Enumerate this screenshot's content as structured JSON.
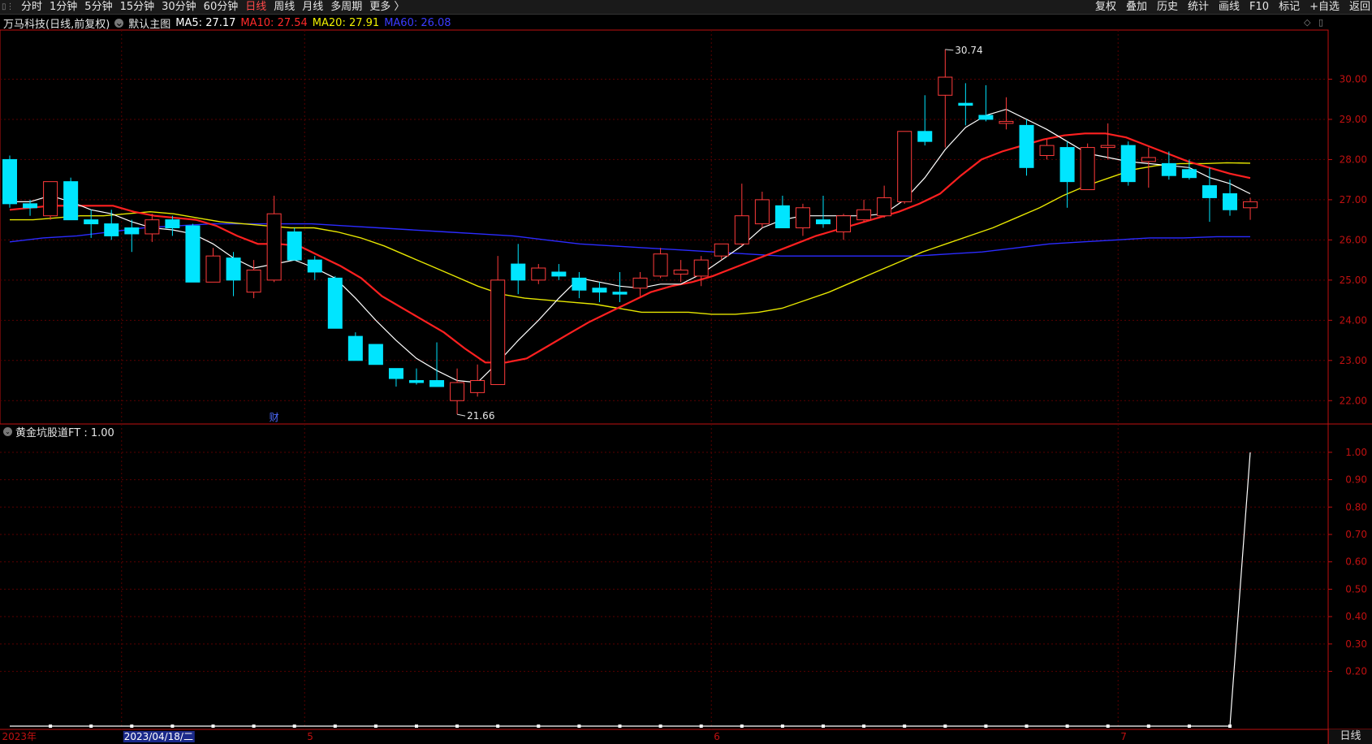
{
  "toolbar": {
    "tabs": [
      {
        "label": "分时",
        "active": false
      },
      {
        "label": "1分钟",
        "active": false
      },
      {
        "label": "5分钟",
        "active": false
      },
      {
        "label": "15分钟",
        "active": false
      },
      {
        "label": "30分钟",
        "active": false
      },
      {
        "label": "60分钟",
        "active": false
      },
      {
        "label": "日线",
        "active": true
      },
      {
        "label": "周线",
        "active": false
      },
      {
        "label": "月线",
        "active": false
      },
      {
        "label": "多周期",
        "active": false
      },
      {
        "label": "更多 〉",
        "active": false
      }
    ],
    "right": [
      "复权",
      "叠加",
      "历史",
      "统计",
      "画线",
      "F10",
      "标记",
      "+自选",
      "返回"
    ]
  },
  "header": {
    "title": "万马科技(日线,前复权)",
    "main_chart_label": "默认主图",
    "ma5": "MA5: 27.17",
    "ma10": "MA10: 27.54",
    "ma20": "MA20: 27.91",
    "ma60": "MA60: 26.08"
  },
  "indicator": {
    "label": "黄金坑股道FT : 1.00"
  },
  "bottom_right_label": "日线",
  "colors": {
    "up": "#ff3b3b",
    "down": "#00e5ff",
    "ma5": "#ffffff",
    "ma10": "#ff2020",
    "ma20": "#e6e600",
    "ma60": "#2b2bff",
    "grid": "#5a0000",
    "axis": "#c01010"
  },
  "chart_data": [
    {
      "type": "candlestick",
      "ylim": [
        21.5,
        31.0
      ],
      "yticks": [
        "30.00",
        "29.00",
        "28.00",
        "27.00",
        "26.00",
        "25.00",
        "24.00",
        "23.00",
        "22.00"
      ],
      "annotations": [
        {
          "text": "30.74",
          "value": 30.74,
          "candle_index": 46
        },
        {
          "text": "21.66",
          "value": 21.66,
          "candle_index": 22
        }
      ],
      "finance_marker": {
        "text": "财",
        "candle_index": 13
      },
      "x_labels": [
        {
          "text": "2023年",
          "candle_index": 0
        },
        {
          "text": "2023/04/18/二",
          "candle_index": 6,
          "highlight": true
        },
        {
          "text": "5",
          "candle_index": 15
        },
        {
          "text": "6",
          "candle_index": 35
        },
        {
          "text": "7",
          "candle_index": 55
        }
      ],
      "candles": [
        {
          "o": 28.0,
          "h": 28.1,
          "l": 26.8,
          "c": 26.9
        },
        {
          "o": 26.9,
          "h": 27.0,
          "l": 26.6,
          "c": 26.8
        },
        {
          "o": 26.6,
          "h": 27.45,
          "l": 26.5,
          "c": 27.45
        },
        {
          "o": 27.45,
          "h": 27.55,
          "l": 26.5,
          "c": 26.5
        },
        {
          "o": 26.5,
          "h": 26.75,
          "l": 26.05,
          "c": 26.4
        },
        {
          "o": 26.4,
          "h": 26.75,
          "l": 26.0,
          "c": 26.1
        },
        {
          "o": 26.3,
          "h": 26.5,
          "l": 25.7,
          "c": 26.15
        },
        {
          "o": 26.15,
          "h": 26.65,
          "l": 25.95,
          "c": 26.5
        },
        {
          "o": 26.5,
          "h": 26.6,
          "l": 26.1,
          "c": 26.3
        },
        {
          "o": 26.35,
          "h": 26.4,
          "l": 24.95,
          "c": 24.95
        },
        {
          "o": 24.95,
          "h": 25.8,
          "l": 24.95,
          "c": 25.6
        },
        {
          "o": 25.55,
          "h": 25.7,
          "l": 24.6,
          "c": 25.0
        },
        {
          "o": 24.7,
          "h": 25.5,
          "l": 24.55,
          "c": 25.25
        },
        {
          "o": 25.0,
          "h": 27.1,
          "l": 24.95,
          "c": 26.65
        },
        {
          "o": 26.2,
          "h": 26.3,
          "l": 25.5,
          "c": 25.5
        },
        {
          "o": 25.5,
          "h": 25.6,
          "l": 25.0,
          "c": 25.2
        },
        {
          "o": 25.05,
          "h": 25.1,
          "l": 23.8,
          "c": 23.8
        },
        {
          "o": 23.6,
          "h": 23.7,
          "l": 23.05,
          "c": 23.0
        },
        {
          "o": 23.4,
          "h": 23.4,
          "l": 22.9,
          "c": 22.9
        },
        {
          "o": 22.8,
          "h": 22.8,
          "l": 22.35,
          "c": 22.55
        },
        {
          "o": 22.5,
          "h": 22.8,
          "l": 22.4,
          "c": 22.45
        },
        {
          "o": 22.5,
          "h": 23.45,
          "l": 22.35,
          "c": 22.35
        },
        {
          "o": 22.0,
          "h": 22.8,
          "l": 21.66,
          "c": 22.45
        },
        {
          "o": 22.2,
          "h": 22.9,
          "l": 22.1,
          "c": 22.5
        },
        {
          "o": 22.4,
          "h": 25.6,
          "l": 22.4,
          "c": 25.0
        },
        {
          "o": 25.4,
          "h": 25.9,
          "l": 24.65,
          "c": 25.0
        },
        {
          "o": 25.0,
          "h": 25.4,
          "l": 24.9,
          "c": 25.3
        },
        {
          "o": 25.2,
          "h": 25.4,
          "l": 25.0,
          "c": 25.1
        },
        {
          "o": 25.05,
          "h": 25.2,
          "l": 24.55,
          "c": 24.75
        },
        {
          "o": 24.8,
          "h": 24.95,
          "l": 24.45,
          "c": 24.7
        },
        {
          "o": 24.7,
          "h": 25.2,
          "l": 24.45,
          "c": 24.65
        },
        {
          "o": 24.8,
          "h": 25.2,
          "l": 24.6,
          "c": 25.05
        },
        {
          "o": 25.1,
          "h": 25.8,
          "l": 25.05,
          "c": 25.65
        },
        {
          "o": 25.15,
          "h": 25.5,
          "l": 24.95,
          "c": 25.25
        },
        {
          "o": 25.1,
          "h": 25.6,
          "l": 24.85,
          "c": 25.5
        },
        {
          "o": 25.6,
          "h": 25.9,
          "l": 25.5,
          "c": 25.9
        },
        {
          "o": 25.9,
          "h": 27.4,
          "l": 25.85,
          "c": 26.6
        },
        {
          "o": 26.4,
          "h": 27.2,
          "l": 26.3,
          "c": 27.0
        },
        {
          "o": 26.85,
          "h": 27.1,
          "l": 26.3,
          "c": 26.3
        },
        {
          "o": 26.3,
          "h": 26.9,
          "l": 26.1,
          "c": 26.8
        },
        {
          "o": 26.5,
          "h": 27.1,
          "l": 26.3,
          "c": 26.4
        },
        {
          "o": 26.2,
          "h": 26.65,
          "l": 26.0,
          "c": 26.6
        },
        {
          "o": 26.5,
          "h": 27.0,
          "l": 26.45,
          "c": 26.75
        },
        {
          "o": 26.6,
          "h": 27.35,
          "l": 26.55,
          "c": 27.05
        },
        {
          "o": 26.95,
          "h": 28.7,
          "l": 26.9,
          "c": 28.7
        },
        {
          "o": 28.7,
          "h": 29.6,
          "l": 28.35,
          "c": 28.45
        },
        {
          "o": 29.6,
          "h": 30.74,
          "l": 28.3,
          "c": 30.05
        },
        {
          "o": 29.4,
          "h": 29.9,
          "l": 28.85,
          "c": 29.35
        },
        {
          "o": 29.1,
          "h": 29.85,
          "l": 28.95,
          "c": 29.0
        },
        {
          "o": 28.9,
          "h": 29.55,
          "l": 28.75,
          "c": 28.95
        },
        {
          "o": 28.85,
          "h": 29.0,
          "l": 27.6,
          "c": 27.8
        },
        {
          "o": 28.1,
          "h": 28.5,
          "l": 28.0,
          "c": 28.35
        },
        {
          "o": 28.3,
          "h": 28.45,
          "l": 26.8,
          "c": 27.45
        },
        {
          "o": 27.25,
          "h": 28.4,
          "l": 27.25,
          "c": 28.3
        },
        {
          "o": 28.3,
          "h": 28.9,
          "l": 28.0,
          "c": 28.35
        },
        {
          "o": 28.35,
          "h": 28.45,
          "l": 27.35,
          "c": 27.45
        },
        {
          "o": 27.95,
          "h": 28.3,
          "l": 27.3,
          "c": 28.05
        },
        {
          "o": 27.9,
          "h": 28.2,
          "l": 27.5,
          "c": 27.6
        },
        {
          "o": 27.75,
          "h": 28.0,
          "l": 27.5,
          "c": 27.55
        },
        {
          "o": 27.35,
          "h": 27.8,
          "l": 26.45,
          "c": 27.05
        },
        {
          "o": 27.15,
          "h": 27.5,
          "l": 26.6,
          "c": 26.75
        },
        {
          "o": 26.8,
          "h": 27.05,
          "l": 26.5,
          "c": 26.95
        }
      ],
      "ma": {
        "MA5": [
          26.95,
          26.95,
          27.1,
          26.95,
          26.75,
          26.65,
          26.45,
          26.3,
          26.25,
          26.15,
          25.9,
          25.55,
          25.3,
          25.4,
          25.5,
          25.3,
          25.05,
          24.55,
          24.0,
          23.5,
          23.05,
          22.75,
          22.5,
          22.45,
          22.95,
          23.5,
          24.0,
          24.55,
          25.05,
          24.95,
          24.85,
          24.8,
          24.9,
          24.9,
          25.15,
          25.5,
          25.85,
          26.3,
          26.5,
          26.6,
          26.6,
          26.6,
          26.6,
          26.65,
          27.0,
          27.55,
          28.25,
          28.8,
          29.1,
          29.25,
          29.0,
          28.75,
          28.45,
          28.15,
          28.05,
          27.95,
          27.9,
          27.85,
          27.8,
          27.55,
          27.4,
          27.15
        ],
        "MA10": [
          26.75,
          26.8,
          26.85,
          26.85,
          26.85,
          26.85,
          26.7,
          26.6,
          26.55,
          26.5,
          26.35,
          26.1,
          25.9,
          25.9,
          25.85,
          25.6,
          25.35,
          25.05,
          24.6,
          24.3,
          24.0,
          23.7,
          23.3,
          22.95,
          22.95,
          23.05,
          23.35,
          23.65,
          23.95,
          24.2,
          24.45,
          24.7,
          24.85,
          24.95,
          25.1,
          25.3,
          25.5,
          25.7,
          25.9,
          26.1,
          26.25,
          26.4,
          26.55,
          26.7,
          26.9,
          27.15,
          27.6,
          28.0,
          28.2,
          28.35,
          28.5,
          28.6,
          28.65,
          28.65,
          28.55,
          28.35,
          28.15,
          27.95,
          27.8,
          27.65,
          27.54
        ],
        "MA20": [
          26.5,
          26.5,
          26.55,
          26.6,
          26.6,
          26.65,
          26.7,
          26.65,
          26.55,
          26.45,
          26.4,
          26.35,
          26.3,
          26.3,
          26.2,
          26.05,
          25.85,
          25.6,
          25.35,
          25.1,
          24.85,
          24.65,
          24.55,
          24.5,
          24.45,
          24.4,
          24.3,
          24.2,
          24.2,
          24.2,
          24.15,
          24.15,
          24.2,
          24.3,
          24.5,
          24.7,
          24.95,
          25.2,
          25.45,
          25.7,
          25.9,
          26.1,
          26.3,
          26.55,
          26.8,
          27.1,
          27.35,
          27.55,
          27.75,
          27.85,
          27.9,
          27.9,
          27.92,
          27.91
        ],
        "MA60": [
          25.95,
          26.05,
          26.1,
          26.2,
          26.3,
          26.35,
          26.4,
          26.4,
          26.4,
          26.4,
          26.35,
          26.3,
          26.25,
          26.2,
          26.15,
          26.1,
          26.0,
          25.9,
          25.85,
          25.8,
          25.75,
          25.7,
          25.65,
          25.6,
          25.6,
          25.6,
          25.6,
          25.6,
          25.65,
          25.7,
          25.8,
          25.9,
          25.95,
          26.0,
          26.05,
          26.05,
          26.08,
          26.08
        ]
      }
    },
    {
      "type": "line",
      "title": "黄金坑股道FT",
      "ylim": [
        0,
        1.05
      ],
      "yticks": [
        "1.00",
        "0.90",
        "0.80",
        "0.70",
        "0.60",
        "0.50",
        "0.40",
        "0.30",
        "0.20"
      ],
      "values_zero_count": 61,
      "last_value": 1.0
    }
  ]
}
